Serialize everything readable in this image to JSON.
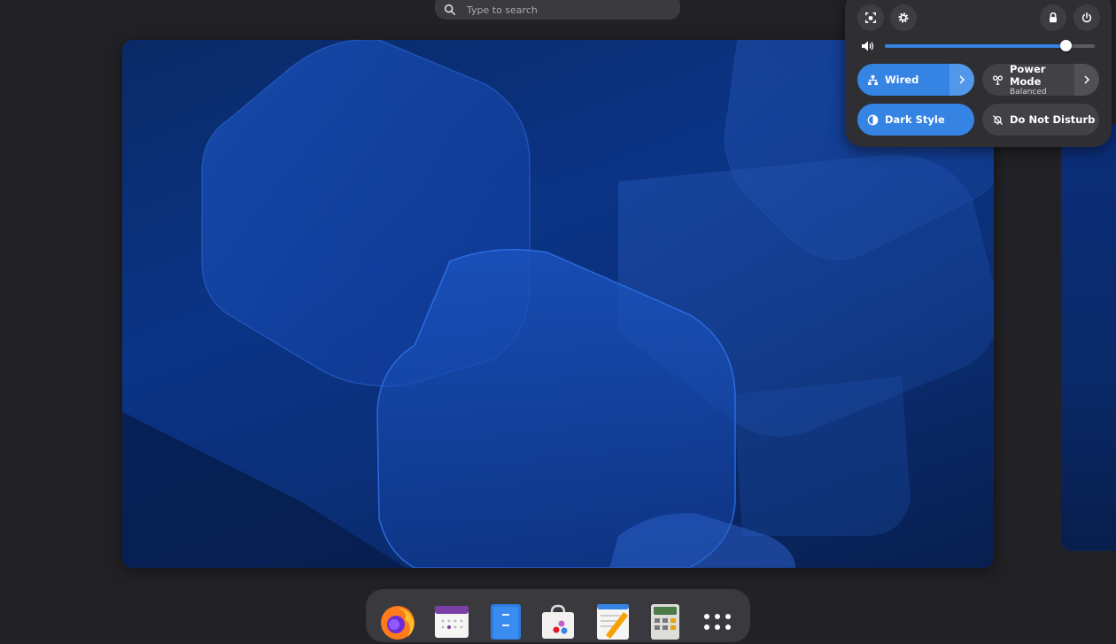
{
  "search": {
    "placeholder": "Type to search",
    "icon": "search-icon"
  },
  "workspace": {
    "wallpaper": "blue-hexagon-wallpaper",
    "colors": {
      "base": "#0b3486",
      "dark": "#081f4f",
      "highlight": "#1f5fd1"
    }
  },
  "quick_settings": {
    "top_buttons": [
      {
        "name": "screenshot",
        "icon": "screenshot-icon"
      },
      {
        "name": "settings",
        "icon": "gear-icon"
      },
      {
        "name": "lock",
        "icon": "lock-icon"
      },
      {
        "name": "power",
        "icon": "power-icon"
      }
    ],
    "volume": {
      "icon": "speaker-icon",
      "level": 0.86
    },
    "tiles": [
      {
        "label": "Wired",
        "icon": "network-icon",
        "active": true,
        "has_menu": true
      },
      {
        "label": "Power Mode",
        "sublabel": "Balanced",
        "icon": "power-mode-icon",
        "active": false,
        "has_menu": true
      },
      {
        "label": "Dark Style",
        "icon": "dark-style-icon",
        "active": true,
        "has_menu": false
      },
      {
        "label": "Do Not Disturb",
        "icon": "bell-off-icon",
        "active": false,
        "has_menu": false
      }
    ],
    "accent_color": "#3584e4"
  },
  "dash": {
    "apps": [
      {
        "name": "firefox",
        "icon": "firefox-icon"
      },
      {
        "name": "calendar",
        "icon": "calendar-icon"
      },
      {
        "name": "files",
        "icon": "files-icon"
      },
      {
        "name": "software",
        "icon": "software-icon"
      },
      {
        "name": "text-editor",
        "icon": "text-editor-icon"
      },
      {
        "name": "calculator",
        "icon": "calculator-icon"
      },
      {
        "name": "show-apps",
        "icon": "app-grid-icon"
      }
    ]
  }
}
